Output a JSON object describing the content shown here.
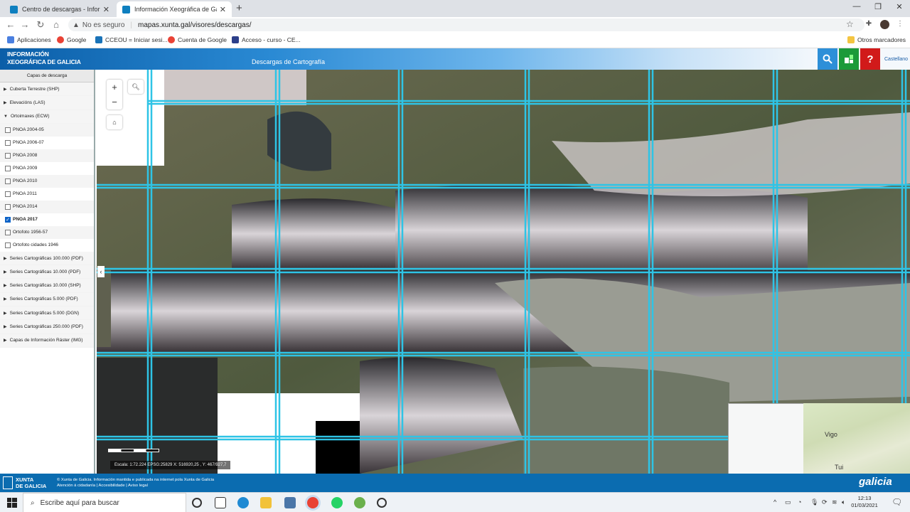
{
  "browser": {
    "tabs": [
      {
        "title": "Centro de descargas - Información Xeográfica",
        "active": false
      },
      {
        "title": "Información Xeográfica de Galicia",
        "active": true
      }
    ],
    "security_label": "No es seguro",
    "url": "mapas.xunta.gal/visores/descargas/",
    "bookmarks": [
      "Aplicaciones",
      "Google",
      "CCEOU = Iniciar sesi...",
      "Cuenta de Google",
      "Acceso - curso - CE..."
    ],
    "other_bookmarks": "Otros marcadores"
  },
  "app": {
    "brand_line1": "INFORMACIÓN",
    "brand_line2": "XEOGRÁFICA DE GALICIA",
    "title": "Descargas de Cartografía",
    "language": "Castellano"
  },
  "sidebar": {
    "header": "Capas de descarga",
    "groups_before": [
      {
        "label": "Cuberta Terrestre (SHP)"
      },
      {
        "label": "Elevacións (LAS)"
      }
    ],
    "expanded_group": {
      "label": "Ortoimaxes (ECW)"
    },
    "subitems": [
      {
        "label": "PNOA 2004-05",
        "checked": false
      },
      {
        "label": "PNOA 2006-07",
        "checked": false
      },
      {
        "label": "PNOA 2008",
        "checked": false
      },
      {
        "label": "PNOA 2009",
        "checked": false
      },
      {
        "label": "PNOA 2010",
        "checked": false
      },
      {
        "label": "PNOA 2011",
        "checked": false
      },
      {
        "label": "PNOA 2014",
        "checked": false
      },
      {
        "label": "PNOA 2017",
        "checked": true
      },
      {
        "label": "Ortofoto 1956-57",
        "checked": false
      },
      {
        "label": "Ortofoto cidades 1946",
        "checked": false
      }
    ],
    "groups_after": [
      {
        "label": "Series Cartográficas 100.000 (PDF)"
      },
      {
        "label": "Series Cartográficas 10.000 (PDF)"
      },
      {
        "label": "Series Cartográficas 10.000 (SHP)"
      },
      {
        "label": "Series Cartográficas 5.000 (PDF)"
      },
      {
        "label": "Series Cartográficas 5.000 (DGN)"
      },
      {
        "label": "Series Cartográficas 250.000 (PDF)"
      },
      {
        "label": "Capas de Información Ráster (IMG)"
      }
    ]
  },
  "map": {
    "zoom_in": "+",
    "zoom_out": "−",
    "status": "Escala: 1:72.224     EPSG:25829   X: 516920,25 , Y: 467/927,7",
    "overview_labels": [
      "Vigo",
      "Tui"
    ],
    "grid_color": "#2ec4e6"
  },
  "footer": {
    "brand_line1": "XUNTA",
    "brand_line2": "DE GALICIA",
    "line1": "© Xunta de Galicia. Información mantida e publicada na internet pola Xunta de Galicia",
    "line2": "Atención á cidadanía | Accesibilidade | Aviso legal",
    "logo": "galicia"
  },
  "taskbar": {
    "search_placeholder": "Escribe aquí para buscar",
    "time": "12:13",
    "date": "01/03/2021"
  }
}
